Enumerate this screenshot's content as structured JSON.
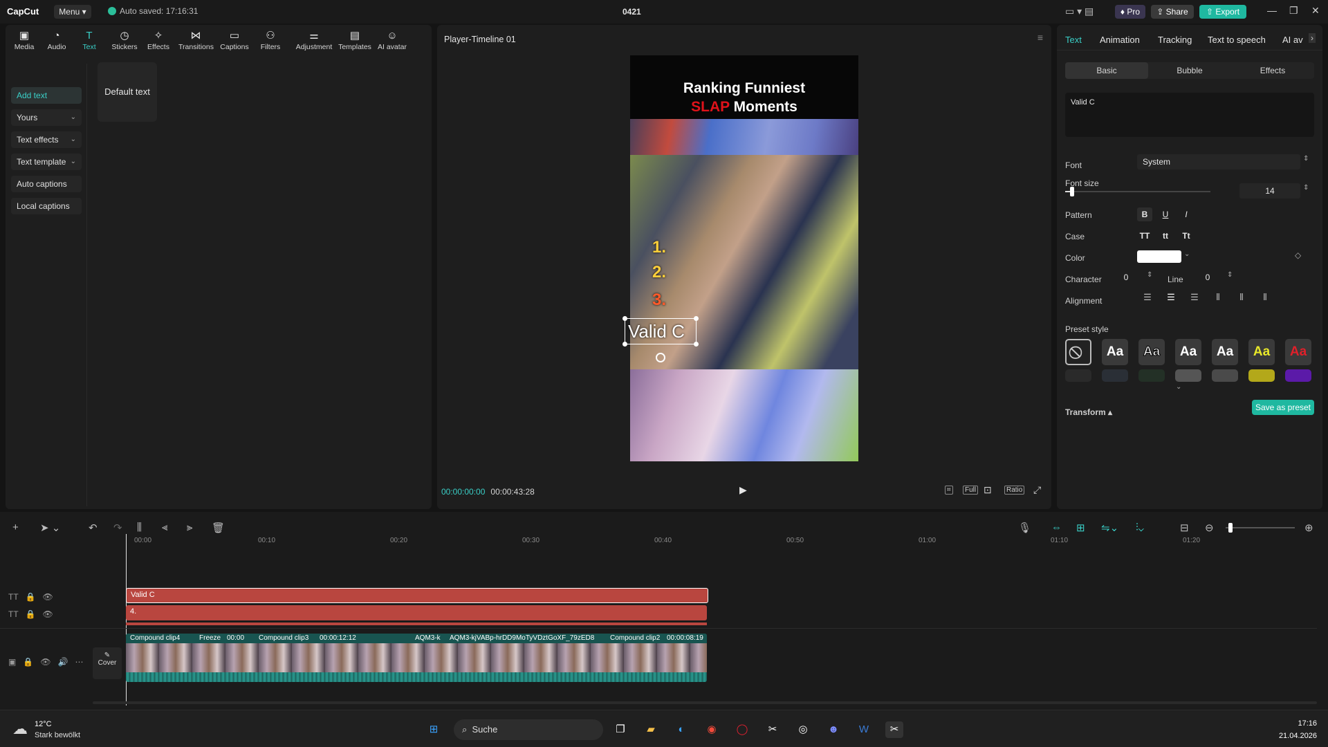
{
  "titlebar": {
    "app_name": "CapCut",
    "menu_label": "Menu",
    "autosave": "Auto saved: 17:16:31",
    "project_title": "0421",
    "pro_label": "Pro",
    "share_label": "Share",
    "export_label": "Export"
  },
  "toolbar": {
    "tools": [
      "Media",
      "Audio",
      "Text",
      "Stickers",
      "Effects",
      "Transitions",
      "Captions",
      "Filters",
      "Adjustment",
      "Templates",
      "AI avatar"
    ],
    "active": "Text"
  },
  "sidebar": {
    "items": [
      {
        "label": "Add text"
      },
      {
        "label": "Yours"
      },
      {
        "label": "Text effects"
      },
      {
        "label": "Text template"
      },
      {
        "label": "Auto captions"
      },
      {
        "label": "Local captions"
      }
    ]
  },
  "content": {
    "default_text": "Default text"
  },
  "player": {
    "title": "Player-Timeline 01",
    "video_title_line1": "Ranking Funniest",
    "video_title_red": "SLAP",
    "video_title_rest": "Moments",
    "rank1": "1.",
    "rank2": "2.",
    "rank3": "3.",
    "overlay_text": "Valid C",
    "time_current": "00:00:00:00",
    "time_total": "00:00:43:28",
    "btn_full": "Full",
    "btn_ratio": "Ratio"
  },
  "inspector": {
    "tabs": [
      "Text",
      "Animation",
      "Tracking",
      "Text to speech",
      "AI av"
    ],
    "active_tab": "Text",
    "subtabs": [
      "Basic",
      "Bubble",
      "Effects"
    ],
    "active_subtab": "Basic",
    "text_value": "Valid C",
    "font_label": "Font",
    "font_value": "System",
    "font_size_label": "Font size",
    "font_size_value": "14",
    "pattern_label": "Pattern",
    "case_label": "Case",
    "case_options": [
      "TT",
      "tt",
      "Tt"
    ],
    "color_label": "Color",
    "color_value": "#ffffff",
    "character_label": "Character",
    "character_value": "0",
    "line_label": "Line",
    "line_value": "0",
    "alignment_label": "Alignment",
    "preset_label": "Preset style",
    "preset_sample": "Aa",
    "transform_label": "Transform",
    "save_preset": "Save as preset"
  },
  "timeline": {
    "ruler": [
      "00:00",
      "00:10",
      "00:20",
      "00:30",
      "00:40",
      "00:50",
      "01:00",
      "01:10",
      "01:20"
    ],
    "text_track1": "Valid C",
    "text_track2": "4.",
    "cover_label": "Cover",
    "video_clips": [
      {
        "name": "Compound clip4"
      },
      {
        "name": "Freeze"
      },
      {
        "name": "00:00"
      },
      {
        "name": "Compound clip3",
        "time": "00:00:12:12"
      },
      {
        "name": "AQM3-k"
      },
      {
        "name": "AQM3-kjVABp-hrDD9MoTyVDztGoXF_79zED8"
      },
      {
        "name": "Compound clip2",
        "time": "00:00:08:19"
      }
    ]
  },
  "taskbar": {
    "temperature": "12°C",
    "weather": "Stark bewölkt",
    "search": "Suche",
    "time": "17:16",
    "date": "21.04.2026"
  },
  "colors": {
    "accent": "#3ad0c8",
    "text_clip": "#b9463f",
    "export": "#1fb8a0"
  }
}
